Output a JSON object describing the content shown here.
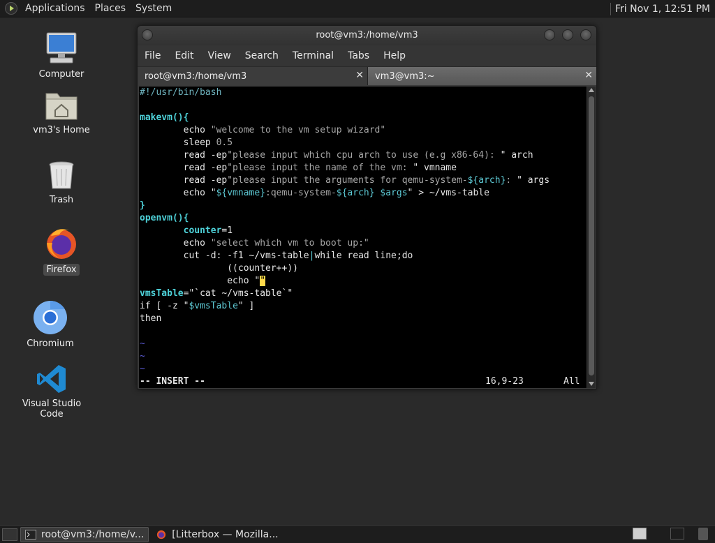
{
  "top_panel": {
    "menus": [
      "Applications",
      "Places",
      "System"
    ],
    "clock": "Fri Nov  1, 12:51 PM"
  },
  "desktop": {
    "icons": [
      {
        "label": "Computer",
        "icon": "computer-icon"
      },
      {
        "label": "vm3's Home",
        "icon": "home-folder-icon"
      },
      {
        "label": "Trash",
        "icon": "trash-icon"
      },
      {
        "label": "Firefox",
        "icon": "firefox-icon",
        "selected": true
      },
      {
        "label": "Chromium",
        "icon": "chromium-icon"
      },
      {
        "label": "Visual Studio Code",
        "icon": "vscode-icon"
      }
    ]
  },
  "terminal": {
    "title": "root@vm3:/home/vm3",
    "menu": [
      "File",
      "Edit",
      "View",
      "Search",
      "Terminal",
      "Tabs",
      "Help"
    ],
    "tabs": [
      {
        "label": "root@vm3:/home/vm3",
        "active": true
      },
      {
        "label": "vm3@vm3:~",
        "active": false
      }
    ],
    "lines": {
      "l1": "#!/usr/bin/bash",
      "l3": "makevm(){",
      "l4a": "        echo ",
      "l4b": "\"welcome to the vm setup wizard\"",
      "l5a": "        sleep ",
      "l5b": "0.5",
      "l6a": "        read -ep",
      "l6b": "\"please input which cpu arch to use (e.g x86-64): ",
      "l6c": "\" arch",
      "l7a": "        read -ep",
      "l7b": "\"please input the name of the vm: ",
      "l7c": "\" vmname",
      "l8a": "        read -ep",
      "l8b": "\"please input the arguments for qemu-system-",
      "l8c": "${arch}",
      "l8d": ": ",
      "l8e": "\" args",
      "l9a": "        echo ",
      "l9b": "\"",
      "l9c": "${vmname}",
      "l9d": ":qemu-system-",
      "l9e": "${arch}",
      "l9f": " ",
      "l9g": "$args",
      "l9h": "\" > ~/vms-table",
      "l10": "}",
      "l11": "openvm(){",
      "l12a": "        counter",
      "l12b": "=1",
      "l13a": "        echo ",
      "l13b": "\"select which vm to boot up:\"",
      "l14a": "        cut -d: -f1 ~/vms-table",
      "l14b": "|",
      "l14c": "while read line;do",
      "l15": "                ((counter++))",
      "l16a": "                echo ",
      "l16b": "\"",
      "l16c": "\"",
      "l17a": "vmsTable",
      "l17b": "=\"`cat ~/vms-table`\"",
      "l18a": "if [ -z \"",
      "l18b": "$vmsTable",
      "l18c": "\" ]",
      "l19": "then",
      "tilde": "~"
    },
    "status": {
      "mode": "-- INSERT --",
      "position": "16,9-23",
      "scroll": "All"
    }
  },
  "taskbar": {
    "tasks": [
      {
        "label": "root@vm3:/home/v...",
        "active": true
      },
      {
        "label": "[Litterbox — Mozilla...",
        "active": false
      }
    ]
  },
  "colors": {
    "panel": "#1d1d1d",
    "desktop": "#2a2a2a",
    "terminal_bg": "#000000",
    "cursor": "#ffd84a"
  }
}
